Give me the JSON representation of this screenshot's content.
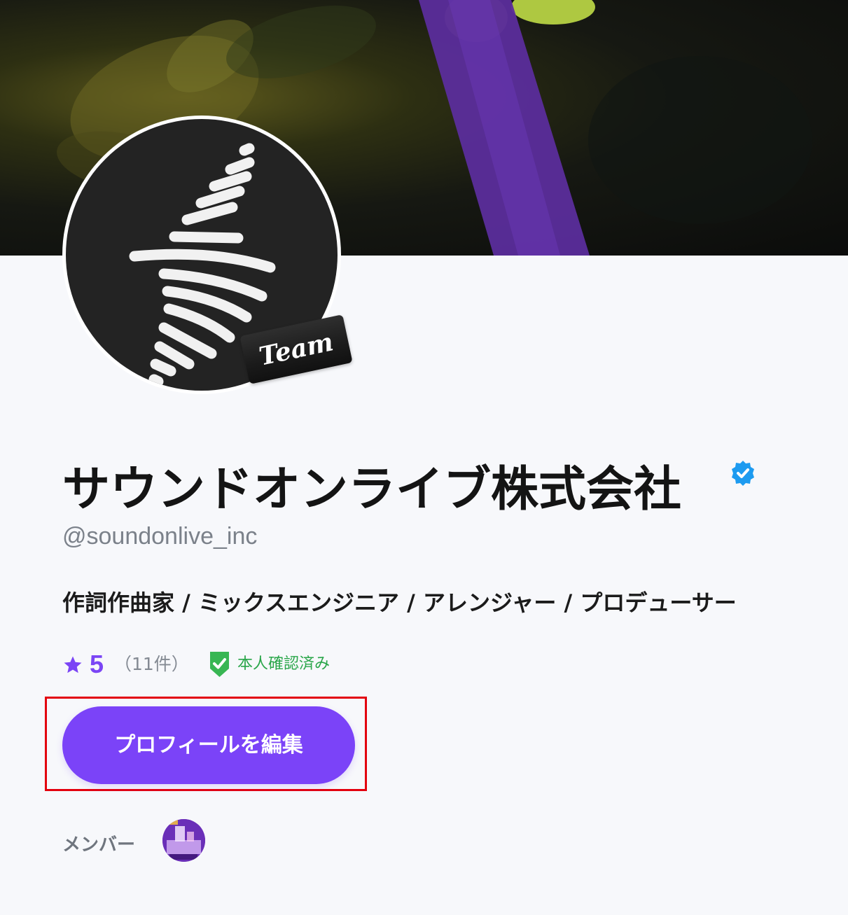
{
  "profile": {
    "name": "サウンドオンライブ株式会社",
    "handle": "@soundonlive_inc",
    "roles": "作詞作曲家 / ミックスエンジニア / アレンジャー / プロデューサー",
    "avatar_badge": "Team",
    "verified_icon": "verified-badge-icon"
  },
  "rating": {
    "value": "5",
    "count_text": "（11件）",
    "icon": "star-icon"
  },
  "identity": {
    "label": "本人確認済み",
    "icon": "shield-check-icon"
  },
  "actions": {
    "edit_profile_label": "プロフィールを編集"
  },
  "members": {
    "label": "メンバー"
  },
  "colors": {
    "accent": "#7b43f8",
    "verified_blue": "#1d9bf0",
    "identity_green": "#2aa64a",
    "highlight_red": "#e3000e"
  }
}
